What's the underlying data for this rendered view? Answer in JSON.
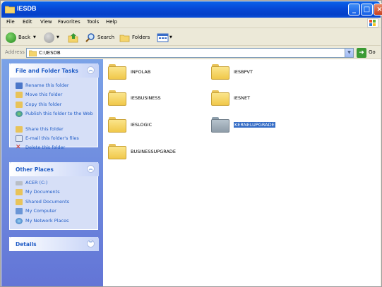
{
  "window": {
    "title": "IESDB"
  },
  "menu": [
    "File",
    "Edit",
    "View",
    "Favorites",
    "Tools",
    "Help"
  ],
  "toolbar": {
    "back_label": "Back",
    "search_label": "Search",
    "folders_label": "Folders"
  },
  "address": {
    "label": "Address",
    "value": "C:\\IESDB",
    "go_label": "Go"
  },
  "tasks_panel": {
    "title": "File and Folder Tasks",
    "items": [
      {
        "label": "Rename this folder",
        "icon": "rename-icon"
      },
      {
        "label": "Move this folder",
        "icon": "move-icon"
      },
      {
        "label": "Copy this folder",
        "icon": "copy-icon"
      },
      {
        "label": "Publish this folder to the Web",
        "icon": "web-publish-icon"
      },
      {
        "label": "Share this folder",
        "icon": "share-icon"
      },
      {
        "label": "E-mail this folder's files",
        "icon": "email-icon"
      },
      {
        "label": "Delete this folder",
        "icon": "delete-icon"
      }
    ]
  },
  "other_places": {
    "title": "Other Places",
    "items": [
      {
        "label": "ACER (C:)",
        "icon": "drive-icon"
      },
      {
        "label": "My Documents",
        "icon": "folder-icon"
      },
      {
        "label": "Shared Documents",
        "icon": "folder-icon"
      },
      {
        "label": "My Computer",
        "icon": "computer-icon"
      },
      {
        "label": "My Network Places",
        "icon": "network-icon"
      }
    ]
  },
  "details": {
    "title": "Details"
  },
  "folders": [
    {
      "name": "INFOLAB",
      "selected": false
    },
    {
      "name": "IESBPVT",
      "selected": false
    },
    {
      "name": "IESBUSINESS",
      "selected": false
    },
    {
      "name": "IESNET",
      "selected": false
    },
    {
      "name": "IESLOGIC",
      "selected": false
    },
    {
      "name": "KERNELUPGRADE",
      "selected": true
    },
    {
      "name": "BUSINESSUPGRADE",
      "selected": false
    }
  ],
  "colors": {
    "titlebar": "#0a62ea",
    "task_link": "#215dc6",
    "selection": "#316ac5"
  }
}
